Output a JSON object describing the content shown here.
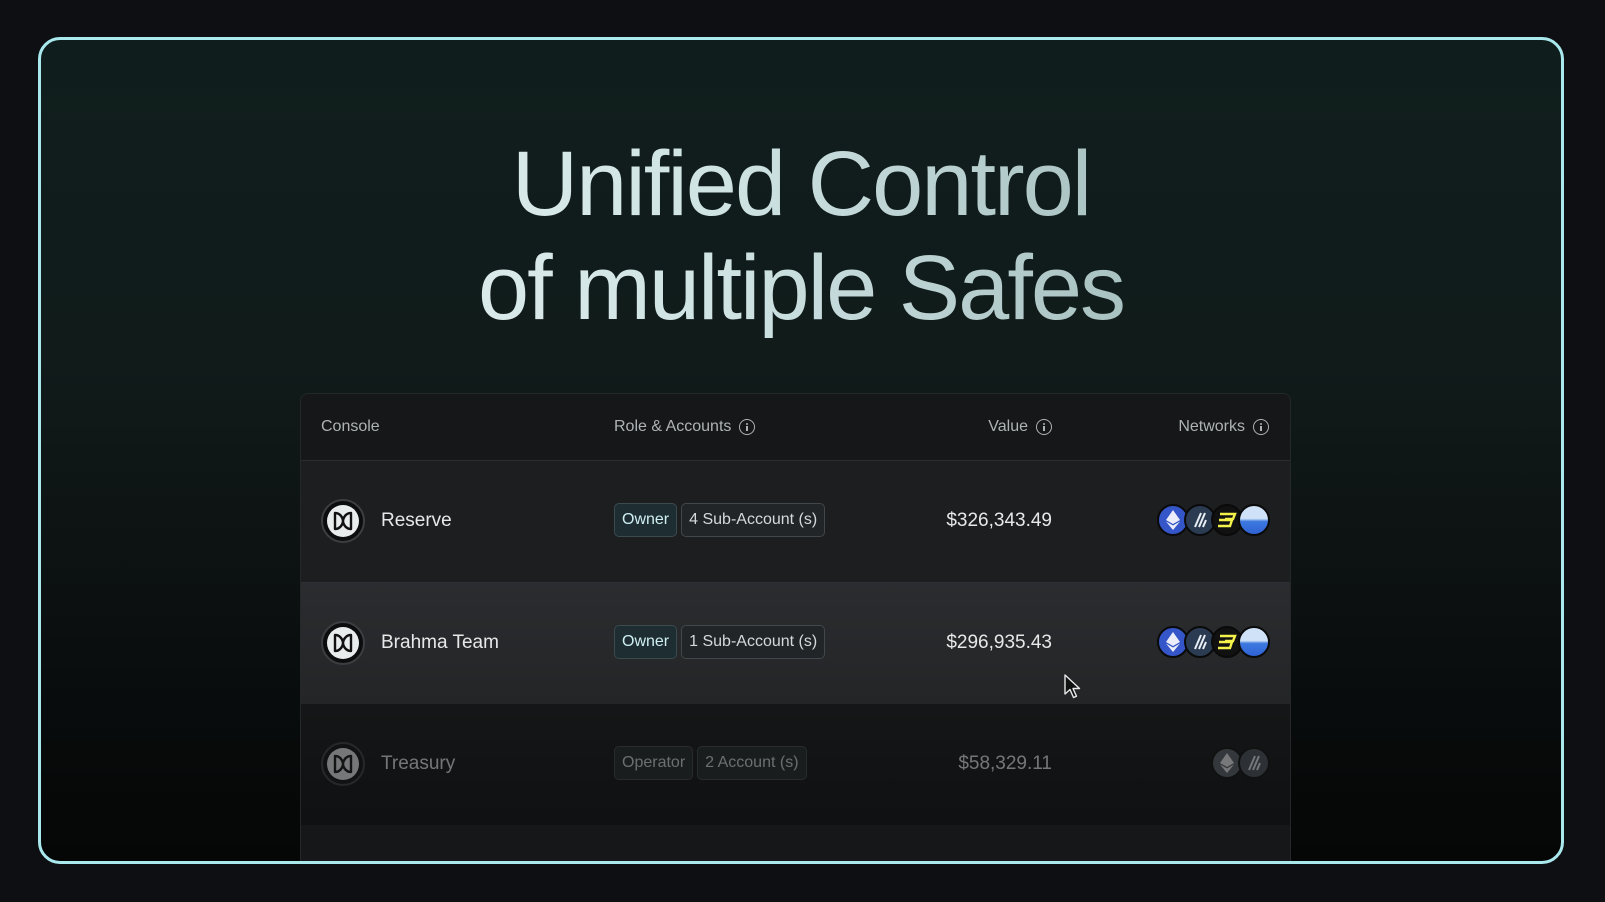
{
  "headline": {
    "line1": "Unified Control",
    "line2": "of multiple Safes"
  },
  "table": {
    "columns": {
      "console": "Console",
      "role_accounts": "Role & Accounts",
      "value": "Value",
      "networks": "Networks"
    },
    "rows": [
      {
        "name": "Reserve",
        "role": "Owner",
        "accounts": "4 Sub-Account (s)",
        "value": "$326,343.49",
        "networks": [
          "ethereum-icon",
          "arbitrum-icon",
          "blast-icon",
          "base-icon"
        ]
      },
      {
        "name": "Brahma Team",
        "role": "Owner",
        "accounts": "1 Sub-Account (s)",
        "value": "$296,935.43",
        "networks": [
          "ethereum-icon",
          "arbitrum-icon",
          "blast-icon",
          "base-icon"
        ]
      },
      {
        "name": "Treasury",
        "role": "Operator",
        "accounts": "2 Account (s)",
        "value": "$58,329.11",
        "networks": [
          "ethereum-icon",
          "arbitrum-icon"
        ]
      }
    ]
  },
  "colors": {
    "frame_border": "#a9e9ee",
    "background": "#0d0f12",
    "table_bg": "#151718"
  }
}
